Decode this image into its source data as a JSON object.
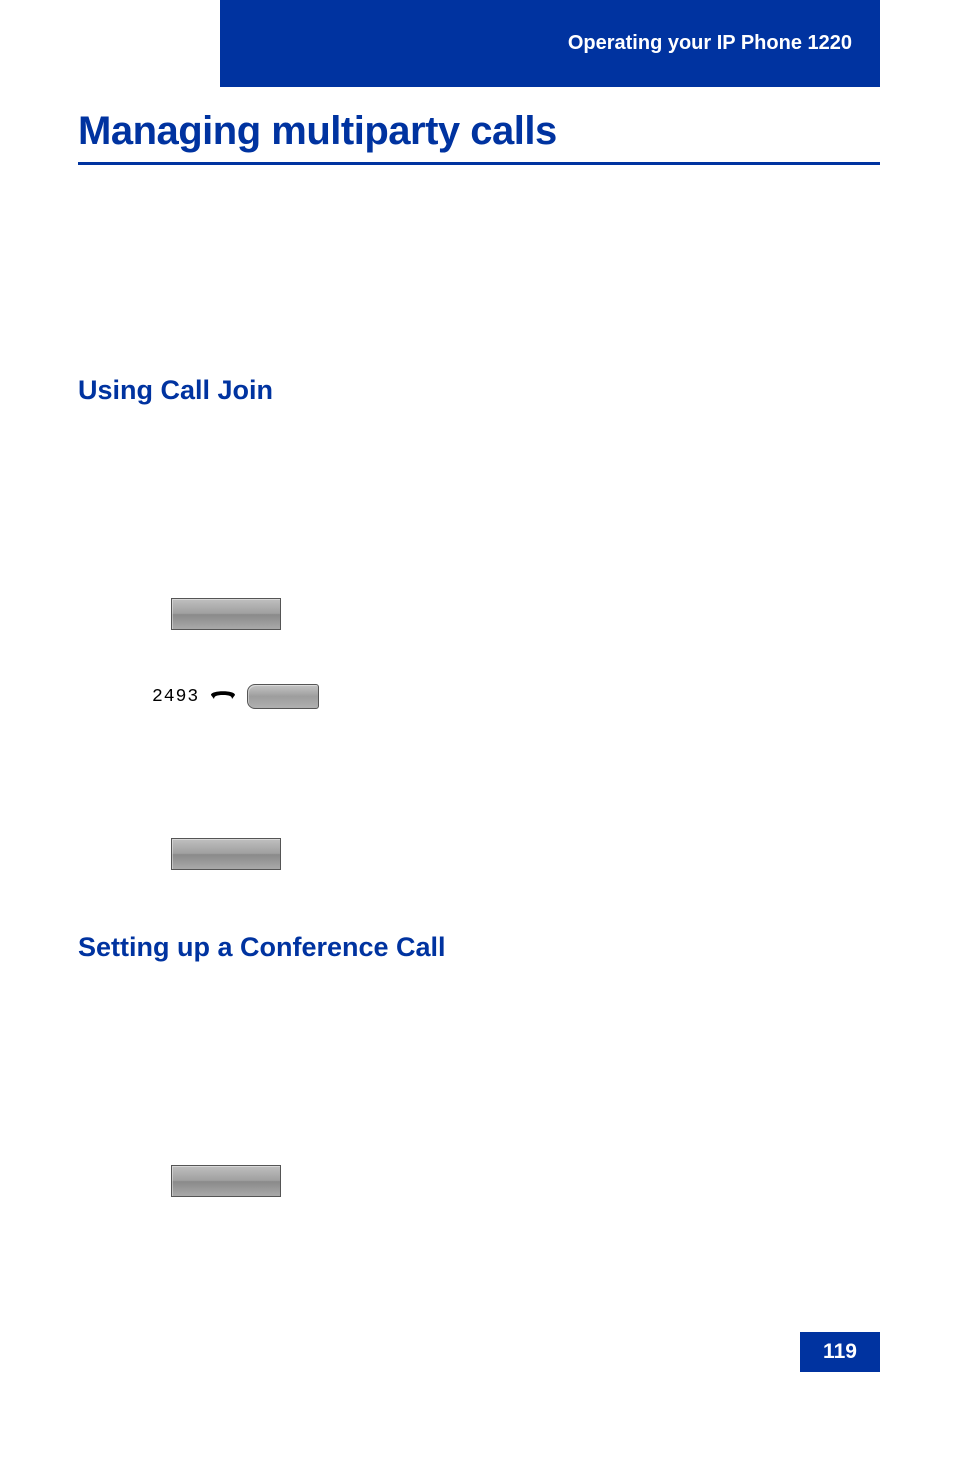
{
  "header": {
    "breadcrumb": "Operating your IP Phone 1220"
  },
  "headings": {
    "main": "Managing multiparty calls",
    "sub1": "Using Call Join",
    "sub2": "Setting up a Conference Call"
  },
  "line": {
    "number": "2493"
  },
  "page": {
    "number": "119"
  }
}
